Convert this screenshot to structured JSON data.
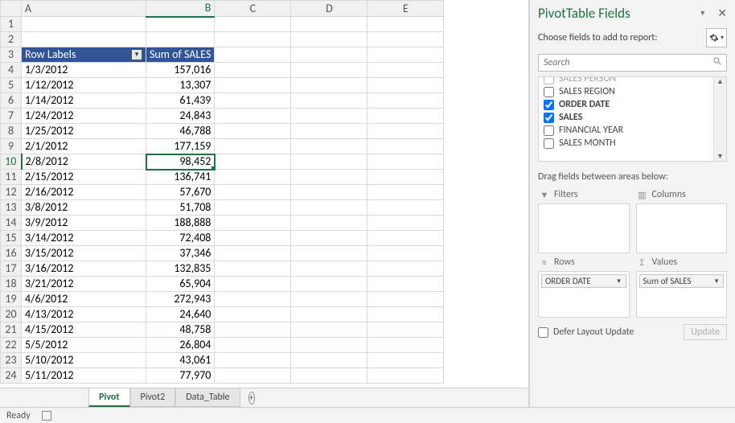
{
  "columns": [
    "A",
    "B",
    "C",
    "D",
    "E"
  ],
  "active_col": "B",
  "active_row": 10,
  "pivot_headers": {
    "row_labels": "Row Labels",
    "values": "Sum of SALES"
  },
  "rows": [
    {
      "n": 1,
      "a": "",
      "b": ""
    },
    {
      "n": 2,
      "a": "",
      "b": ""
    },
    {
      "n": 3,
      "header": true
    },
    {
      "n": 4,
      "a": "1/3/2012",
      "b": "157,016"
    },
    {
      "n": 5,
      "a": "1/12/2012",
      "b": "13,307"
    },
    {
      "n": 6,
      "a": "1/14/2012",
      "b": "61,439"
    },
    {
      "n": 7,
      "a": "1/24/2012",
      "b": "24,843"
    },
    {
      "n": 8,
      "a": "1/25/2012",
      "b": "46,788"
    },
    {
      "n": 9,
      "a": "2/1/2012",
      "b": "177,159"
    },
    {
      "n": 10,
      "a": "2/8/2012",
      "b": "98,452",
      "active": true
    },
    {
      "n": 11,
      "a": "2/15/2012",
      "b": "136,741"
    },
    {
      "n": 12,
      "a": "2/16/2012",
      "b": "57,670"
    },
    {
      "n": 13,
      "a": "3/8/2012",
      "b": "51,708"
    },
    {
      "n": 14,
      "a": "3/9/2012",
      "b": "188,888"
    },
    {
      "n": 15,
      "a": "3/14/2012",
      "b": "72,408"
    },
    {
      "n": 16,
      "a": "3/15/2012",
      "b": "37,346"
    },
    {
      "n": 17,
      "a": "3/16/2012",
      "b": "132,835"
    },
    {
      "n": 18,
      "a": "3/21/2012",
      "b": "65,904"
    },
    {
      "n": 19,
      "a": "4/6/2012",
      "b": "272,943"
    },
    {
      "n": 20,
      "a": "4/13/2012",
      "b": "24,640"
    },
    {
      "n": 21,
      "a": "4/15/2012",
      "b": "48,758"
    },
    {
      "n": 22,
      "a": "5/5/2012",
      "b": "26,804"
    },
    {
      "n": 23,
      "a": "5/10/2012",
      "b": "43,061"
    },
    {
      "n": 24,
      "a": "5/11/2012",
      "b": "77,970"
    }
  ],
  "sheet_tabs": [
    {
      "label": "Pivot",
      "active": true
    },
    {
      "label": "Pivot2",
      "active": false
    },
    {
      "label": "Data_Table",
      "active": false
    }
  ],
  "status": {
    "ready": "Ready"
  },
  "pane": {
    "title": "PivotTable Fields",
    "choose": "Choose fields to add to report:",
    "search_placeholder": "Search",
    "fields": [
      {
        "label": "SALES PERSON",
        "checked": false,
        "cut": true
      },
      {
        "label": "SALES REGION",
        "checked": false
      },
      {
        "label": "ORDER DATE",
        "checked": true
      },
      {
        "label": "SALES",
        "checked": true
      },
      {
        "label": "FINANCIAL YEAR",
        "checked": false
      },
      {
        "label": "SALES MONTH",
        "checked": false
      }
    ],
    "drag_note": "Drag fields between areas below:",
    "areas": {
      "filters": {
        "title": "Filters",
        "items": []
      },
      "columns": {
        "title": "Columns",
        "items": []
      },
      "rows": {
        "title": "Rows",
        "items": [
          "ORDER DATE"
        ]
      },
      "values": {
        "title": "Values",
        "items": [
          "Sum of SALES"
        ]
      }
    },
    "defer": "Defer Layout Update",
    "update": "Update"
  }
}
